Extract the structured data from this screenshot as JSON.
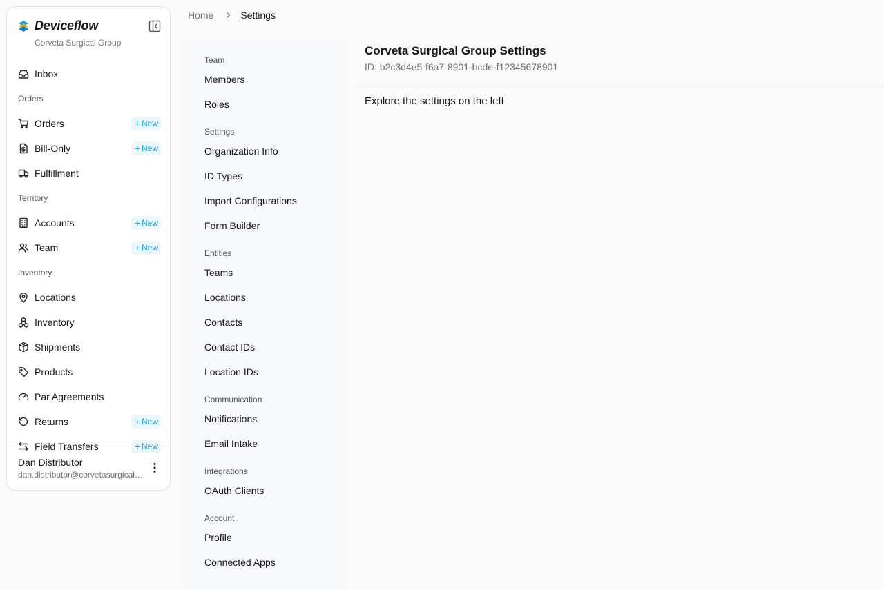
{
  "app": {
    "name": "Deviceflow",
    "org": "Corveta Surgical Group",
    "brand_color": "#0ea5e9",
    "accent_pill_bg": "#ecf6fd"
  },
  "sidebar": {
    "items": [
      {
        "type": "item",
        "label": "Inbox",
        "icon": "inbox-icon"
      },
      {
        "type": "group",
        "label": "Orders"
      },
      {
        "type": "item",
        "label": "Orders",
        "icon": "cart-icon",
        "new": "New"
      },
      {
        "type": "item",
        "label": "Bill-Only",
        "icon": "dollar-doc-icon",
        "new": "New"
      },
      {
        "type": "item",
        "label": "Fulfillment",
        "icon": "truck-icon"
      },
      {
        "type": "group",
        "label": "Territory"
      },
      {
        "type": "item",
        "label": "Accounts",
        "icon": "building-icon",
        "new": "New"
      },
      {
        "type": "item",
        "label": "Team",
        "icon": "users-icon",
        "new": "New"
      },
      {
        "type": "group",
        "label": "Inventory"
      },
      {
        "type": "item",
        "label": "Locations",
        "icon": "map-pin-icon"
      },
      {
        "type": "item",
        "label": "Inventory",
        "icon": "boxes-icon"
      },
      {
        "type": "item",
        "label": "Shipments",
        "icon": "package-icon"
      },
      {
        "type": "item",
        "label": "Products",
        "icon": "tag-icon"
      },
      {
        "type": "item",
        "label": "Par Agreements",
        "icon": "gauge-icon"
      },
      {
        "type": "item",
        "label": "Returns",
        "icon": "rotate-ccw-icon",
        "new": "New"
      },
      {
        "type": "item",
        "label": "Field Transfers",
        "icon": "arrows-transfer-icon",
        "new": "New"
      }
    ]
  },
  "user": {
    "name": "Dan Distributor",
    "email": "dan.distributor@corvetasurgicalgroup.com"
  },
  "breadcrumb": {
    "home": "Home",
    "current": "Settings"
  },
  "settings_nav": {
    "groups": [
      {
        "label": "Team",
        "links": [
          "Members",
          "Roles"
        ]
      },
      {
        "label": "Settings",
        "links": [
          "Organization Info",
          "ID Types",
          "Import Configurations",
          "Form Builder"
        ]
      },
      {
        "label": "Entities",
        "links": [
          "Teams",
          "Locations",
          "Contacts",
          "Contact IDs",
          "Location IDs"
        ]
      },
      {
        "label": "Communication",
        "links": [
          "Notifications",
          "Email Intake"
        ]
      },
      {
        "label": "Integrations",
        "links": [
          "OAuth Clients"
        ]
      },
      {
        "label": "Account",
        "links": [
          "Profile",
          "Connected Apps"
        ]
      }
    ]
  },
  "main": {
    "title": "Corveta Surgical Group Settings",
    "id_text": "ID: b2c3d4e5-f6a7-8901-bcde-f12345678901",
    "body": "Explore the settings on the left"
  }
}
